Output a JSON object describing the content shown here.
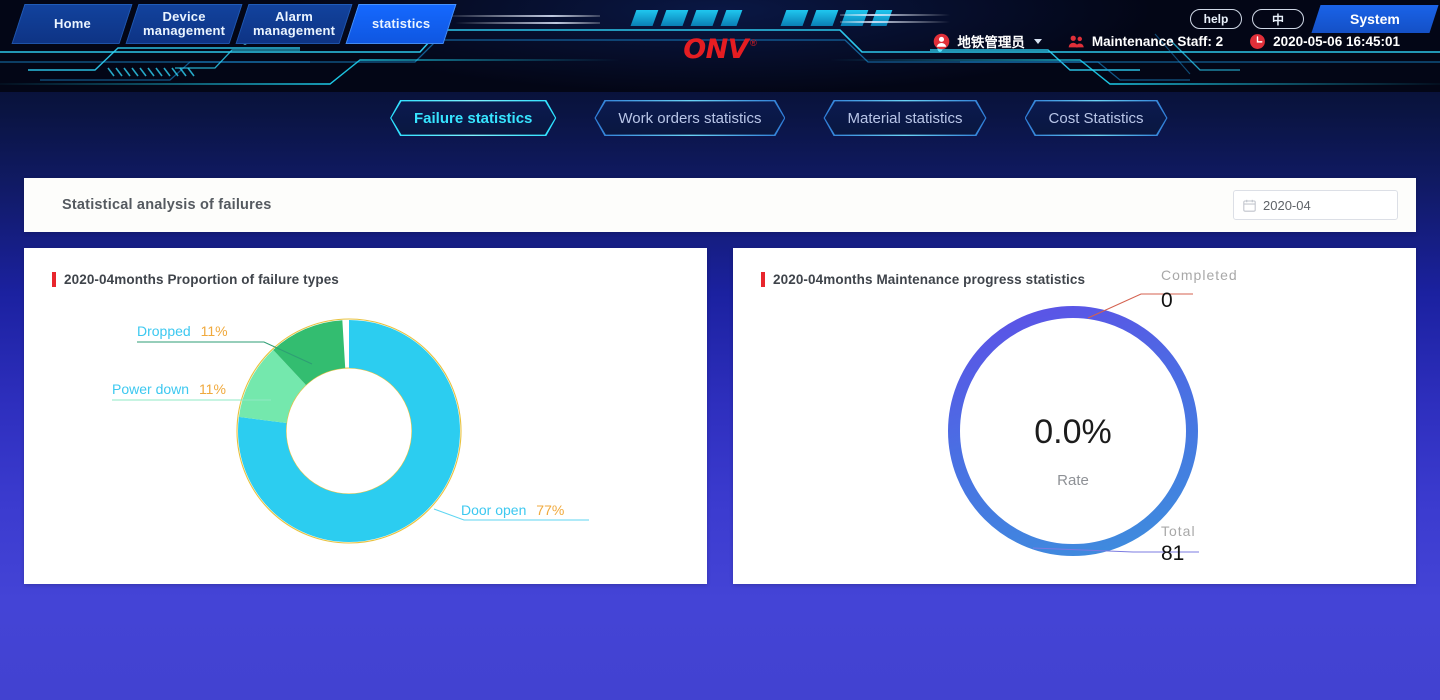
{
  "header": {
    "nav": [
      {
        "label": "Home",
        "active": false
      },
      {
        "label": "Device\nmanagement",
        "active": false
      },
      {
        "label": "Alarm\nmanagement",
        "active": false
      },
      {
        "label": "statistics",
        "active": true
      }
    ],
    "help_label": "help",
    "lang_label": "中",
    "system_label": "System",
    "user_name": "地铁管理员",
    "maintenance_staff": "Maintenance Staff: 2",
    "datetime": "2020-05-06 16:45:01",
    "logo_text": "ONV",
    "logo_reg": "®",
    "icons": {
      "user": "user-avatar-icon",
      "staff": "people-group-icon",
      "clock": "clock-icon",
      "caret": "chevron-down-icon"
    }
  },
  "subtabs": [
    {
      "label": "Failure statistics",
      "active": true
    },
    {
      "label": "Work orders statistics",
      "active": false
    },
    {
      "label": "Material statistics",
      "active": false
    },
    {
      "label": "Cost Statistics",
      "active": false
    }
  ],
  "panel": {
    "title": "Statistical analysis of failures",
    "date_value": "2020-04",
    "date_icon": "calendar-icon"
  },
  "chart_data": [
    {
      "type": "pie",
      "title": "2020-04months Proportion of failure types",
      "subtype": "donut",
      "categories": [
        "Door open",
        "Power down",
        "Dropped"
      ],
      "values": [
        77,
        11,
        11
      ],
      "unit": "%",
      "colors": [
        "#2ccdf0",
        "#74e8ad",
        "#33bd70"
      ],
      "labels": [
        {
          "name": "Dropped",
          "pct": "11%",
          "color_name": "#3cc8f0",
          "color_pct": "#f0a93c"
        },
        {
          "name": "Power down",
          "pct": "11%",
          "color_name": "#3cc8f0",
          "color_pct": "#f0a93c"
        },
        {
          "name": "Door open",
          "pct": "77%",
          "color_name": "#3cc8f0",
          "color_pct": "#f0a93c"
        }
      ],
      "guide_ring_color": "#e8c23f",
      "legend": "labels-with-leader-lines"
    },
    {
      "type": "pie",
      "title": "2020-04months Maintenance progress statistics",
      "subtype": "gauge-ring",
      "center_value": "0.0%",
      "center_label": "Rate",
      "annotations": [
        {
          "label": "Completed",
          "value": "0",
          "leader_color": "#d4614f"
        },
        {
          "label": "Total",
          "value": "81",
          "leader_color": "#7b7be0"
        }
      ],
      "ring_gradient": [
        "#5a55e6",
        "#3f8ade"
      ],
      "values": [
        0,
        81
      ],
      "categories": [
        "Completed",
        "Total"
      ]
    }
  ]
}
